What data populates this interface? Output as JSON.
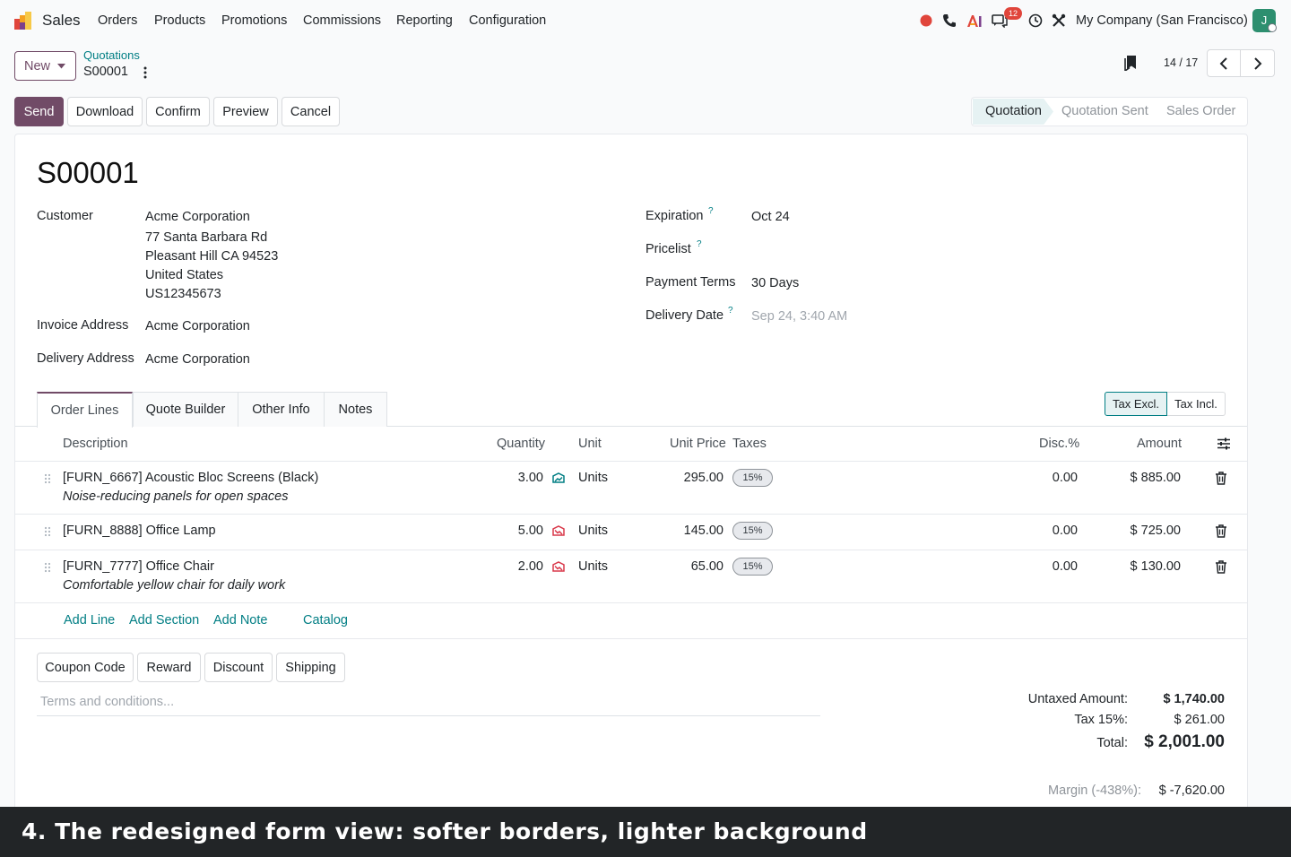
{
  "topnav": {
    "app_name": "Sales",
    "menu": [
      "Orders",
      "Products",
      "Promotions",
      "Commissions",
      "Reporting",
      "Configuration"
    ],
    "badge_count": "12",
    "company": "My Company (San Francisco)",
    "avatar_letter": "J",
    "icons": [
      "record-icon",
      "phone-icon",
      "ai-icon",
      "chat-icon",
      "clock-icon",
      "tools-icon"
    ]
  },
  "control": {
    "new_label": "New",
    "breadcrumb_parent": "Quotations",
    "breadcrumb_current": "S00001",
    "pager": "14 / 17"
  },
  "actions": [
    "Send",
    "Download",
    "Confirm",
    "Preview",
    "Cancel"
  ],
  "status": [
    "Quotation",
    "Quotation Sent",
    "Sales Order"
  ],
  "form": {
    "title": "S00001",
    "customer_label": "Customer",
    "customer_lines": [
      "Acme Corporation",
      "77 Santa Barbara Rd",
      "Pleasant Hill CA 94523",
      "United States",
      "US12345673"
    ],
    "invoice_label": "Invoice Address",
    "invoice_value": "Acme Corporation",
    "delivery_label": "Delivery Address",
    "delivery_value": "Acme Corporation",
    "expiration_label": "Expiration",
    "expiration_value": "Oct 24",
    "pricelist_label": "Pricelist",
    "payment_label": "Payment Terms",
    "payment_value": "30 Days",
    "delivery_date_label": "Delivery Date",
    "delivery_date_value": "Sep 24, 3:40 AM",
    "help_mark": "?"
  },
  "tabs": [
    "Order Lines",
    "Quote Builder",
    "Other Info",
    "Notes"
  ],
  "tax_toggle": [
    "Tax Excl.",
    "Tax Incl."
  ],
  "table": {
    "headers": [
      "Description",
      "Quantity",
      "Unit",
      "Unit Price",
      "Taxes",
      "Disc.%",
      "Amount"
    ],
    "rows": [
      {
        "desc": "[FURN_6667] Acoustic Bloc Screens (Black)",
        "desc2": "Noise-reducing panels for open spaces",
        "qty": "3.00",
        "forecast": "ok",
        "unit": "Units",
        "price": "295.00",
        "tax": "15%",
        "disc": "0.00",
        "amount": "$ 885.00"
      },
      {
        "desc": "[FURN_8888] Office Lamp",
        "desc2": "",
        "qty": "5.00",
        "forecast": "warn",
        "unit": "Units",
        "price": "145.00",
        "tax": "15%",
        "disc": "0.00",
        "amount": "$ 725.00"
      },
      {
        "desc": "[FURN_7777] Office Chair",
        "desc2": "Comfortable yellow chair for daily work",
        "qty": "2.00",
        "forecast": "warn",
        "unit": "Units",
        "price": "65.00",
        "tax": "15%",
        "disc": "0.00",
        "amount": "$ 130.00"
      }
    ],
    "links": [
      "Add Line",
      "Add Section",
      "Add Note",
      "Catalog"
    ]
  },
  "rewards": [
    "Coupon Code",
    "Reward",
    "Discount",
    "Shipping"
  ],
  "terms_placeholder": "Terms and conditions...",
  "totals": {
    "untaxed_label": "Untaxed Amount:",
    "untaxed_value": "$ 1,740.00",
    "tax_label": "Tax 15%:",
    "tax_value": "$ 261.00",
    "total_label": "Total:",
    "total_value": "$ 2,001.00",
    "margin_label": "Margin (-438%):",
    "margin_value": "$ -7,620.00"
  },
  "caption": "4. The redesigned form view: softer borders, lighter background",
  "colors": {
    "brand": "#714b67",
    "accent": "#017e84",
    "danger": "#e0453b"
  }
}
